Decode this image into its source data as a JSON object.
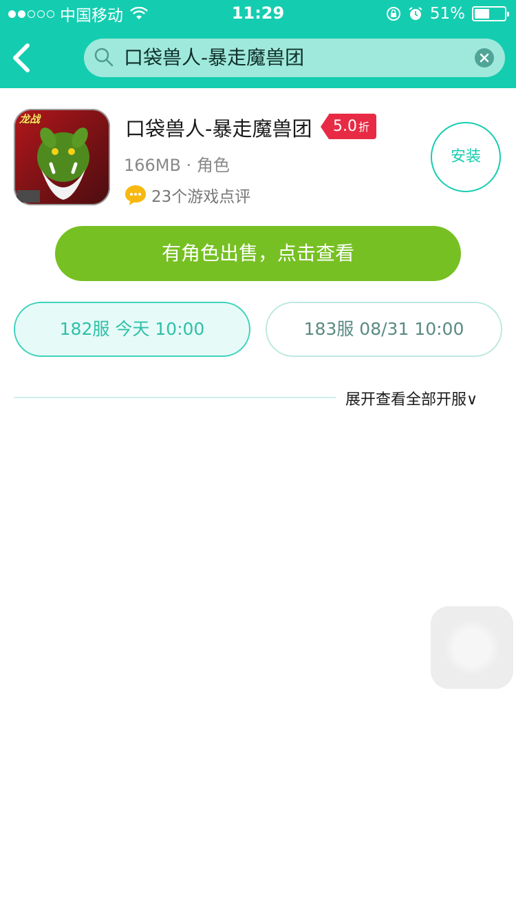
{
  "status_bar": {
    "carrier": "中国移动",
    "time": "11:29",
    "battery_percent": "51%",
    "battery_level": 0.51,
    "icons": [
      "wifi-icon",
      "orientation-lock-icon",
      "alarm-icon",
      "battery-icon"
    ]
  },
  "header": {
    "back_icon": "chevron-left-icon",
    "search_value": "口袋兽人-暴走魔兽团",
    "search_icon": "search-icon",
    "clear_icon": "close-circle-icon"
  },
  "game": {
    "title": "口袋兽人-暴走魔兽团",
    "discount_value": "5.0",
    "discount_unit": "折",
    "size": "166MB",
    "separator": " · ",
    "category": "角色",
    "reviews": "23个游戏点评",
    "install_label": "安装",
    "icon_badge": "龙战"
  },
  "sale_button": "有角色出售，点击查看",
  "servers": [
    {
      "label": "182服 今天  10:00",
      "active": true
    },
    {
      "label": "183服 08/31 10:00",
      "active": false
    }
  ],
  "expand_label": "展开查看全部开服∨",
  "colors": {
    "primary": "#14cdb0",
    "search_bg": "#9fe9dc",
    "discount": "#e82b45",
    "sale_green": "#76c023"
  }
}
